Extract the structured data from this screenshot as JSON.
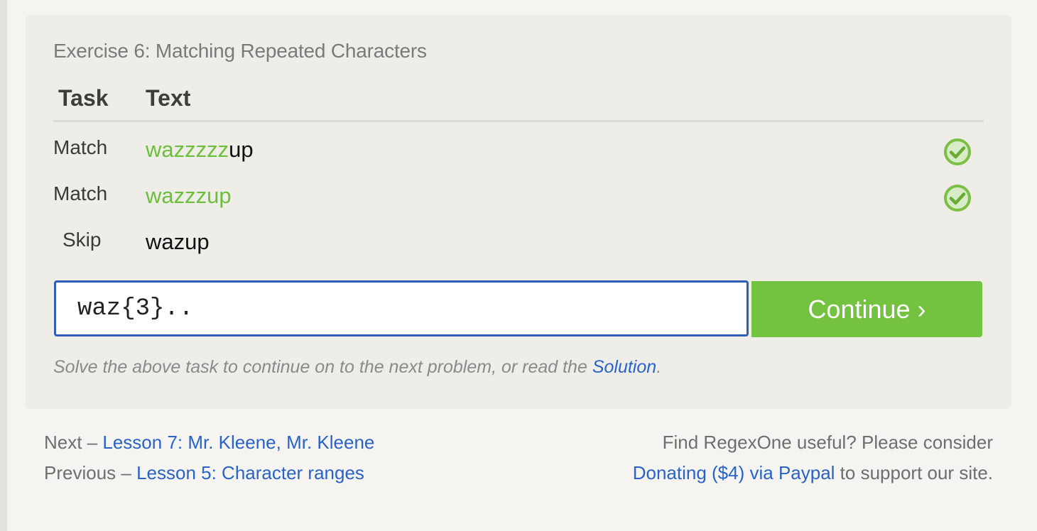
{
  "exercise": {
    "title": "Exercise 6: Matching Repeated Characters",
    "headers": {
      "task": "Task",
      "text": "Text"
    },
    "rows": [
      {
        "task": "Match",
        "matched": "wazzzzz",
        "rest": "up",
        "status": "check-icon"
      },
      {
        "task": "Match",
        "matched": "wazzzup",
        "rest": "",
        "status": "check-icon"
      },
      {
        "task": "Skip",
        "matched": "",
        "rest": "wazup",
        "status": ""
      }
    ],
    "input_value": "waz{3}..",
    "continue_label": "Continue ›",
    "hint_prefix": "Solve the above task to continue on to the next problem, or read the ",
    "hint_link": "Solution",
    "hint_suffix": "."
  },
  "footer": {
    "next_prefix": "Next – ",
    "next_link": "Lesson 7: Mr. Kleene, Mr. Kleene",
    "prev_prefix": "Previous – ",
    "prev_link": "Lesson 5: Character ranges",
    "support_line1": "Find RegexOne useful? Please consider",
    "donate_link": "Donating ($4) via Paypal",
    "support_suffix": " to support our site."
  },
  "colors": {
    "match_green": "#6cbf3a",
    "button_green": "#74c340",
    "link_blue": "#2a63c6",
    "input_border": "#2f5fb8"
  }
}
